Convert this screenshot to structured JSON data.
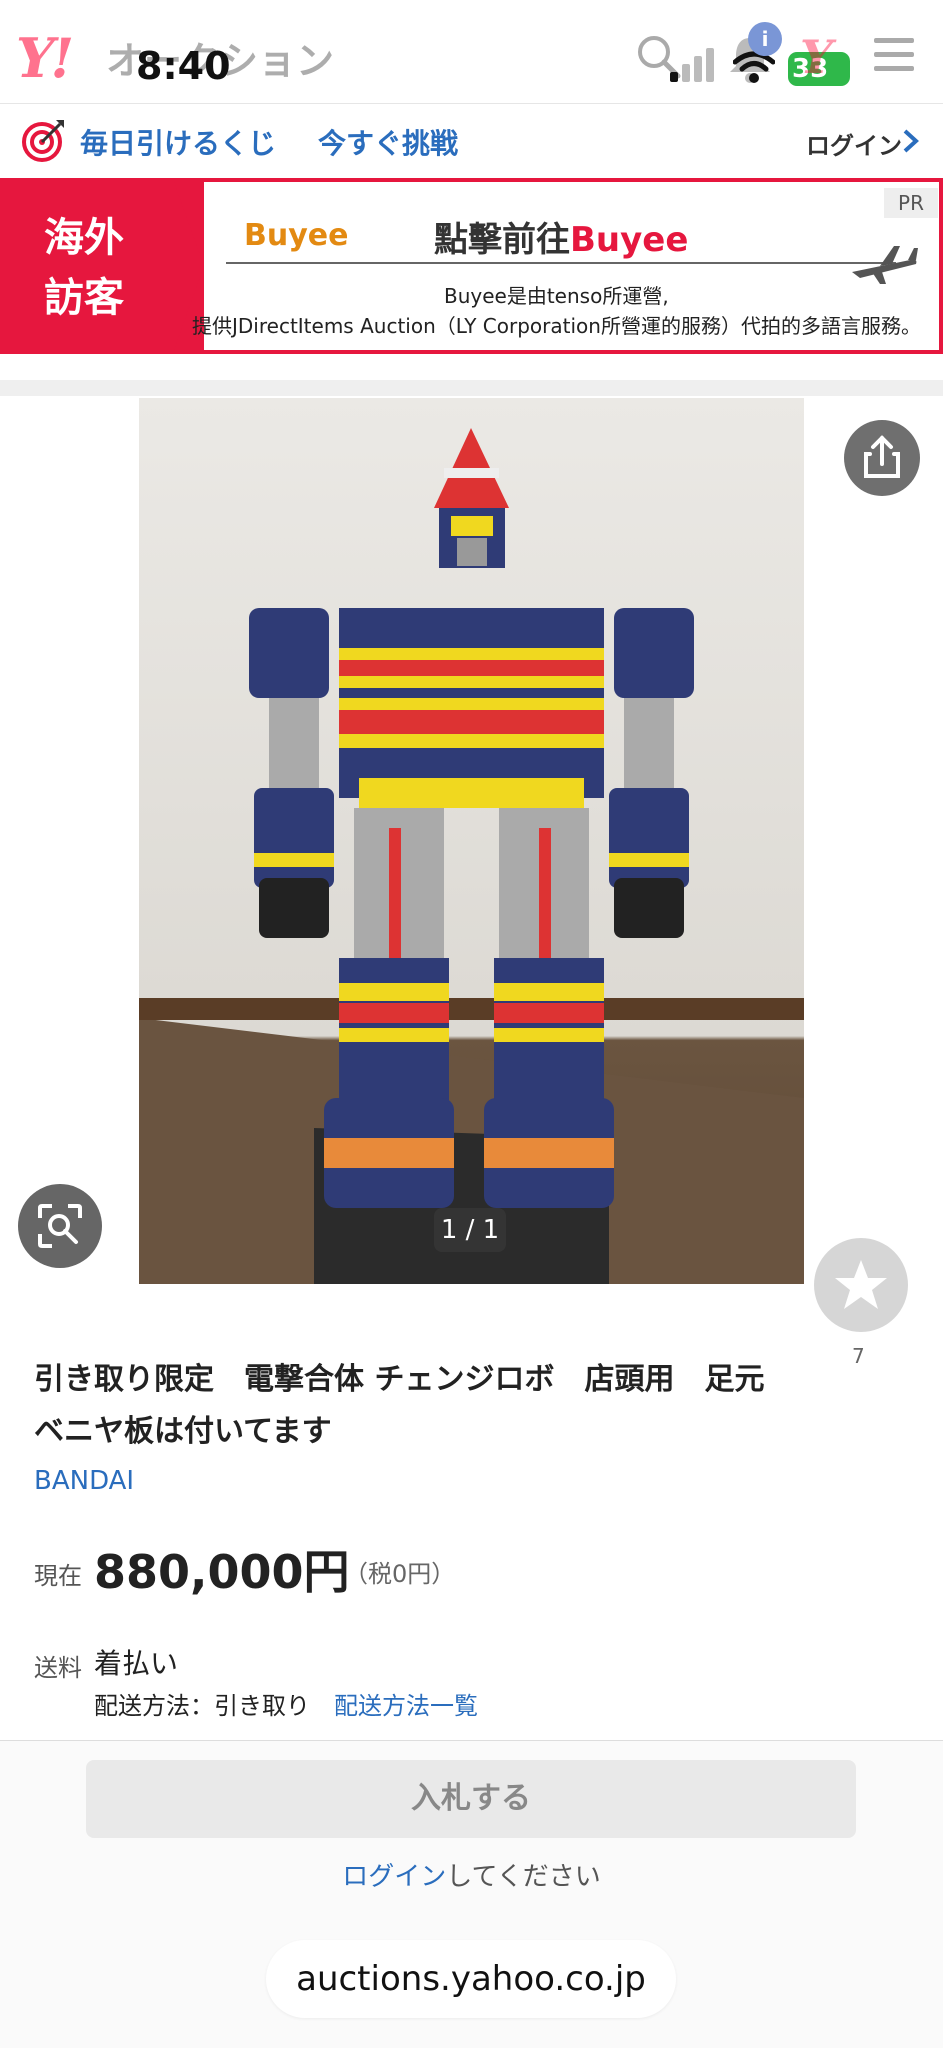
{
  "header": {
    "logo_y": "Y!",
    "logo_text": "オークション",
    "status_time": "8:40",
    "notification_badge": "i",
    "battery_level": "33"
  },
  "lottery_bar": {
    "text1": "毎日引けるくじ",
    "text2": "今すぐ挑戦",
    "login": "ログイン"
  },
  "banner": {
    "left_text": "海外訪客",
    "buyee_logo": "Buyee",
    "headline_prefix": "點擊前往",
    "headline_brand": "Buyee",
    "pr": "PR",
    "desc1": "Buyee是由tenso所運營,",
    "desc2": "提供JDirectItems Auction（LY Corporation所營運的服務）代拍的多語言服務。"
  },
  "image": {
    "counter": "1 / 1",
    "watch_count": "7"
  },
  "product": {
    "title": "引き取り限定　電撃合体 チェンジロボ　店頭用　足元ベニヤ板は付いてます",
    "brand": "BANDAI",
    "price_label": "現在",
    "price": "880,000円",
    "tax": "（税0円）",
    "shipping_label": "送料",
    "shipping_value": "着払い",
    "shipping_method": "配送方法：引き取り",
    "shipping_method_link": "配送方法一覧"
  },
  "bid": {
    "button": "入札する",
    "login_link": "ログイン",
    "login_suffix": "してください"
  },
  "browser": {
    "url": "auctions.yahoo.co.jp"
  },
  "colors": {
    "accent_red": "#e6173e",
    "link_blue": "#2a6dbd"
  }
}
